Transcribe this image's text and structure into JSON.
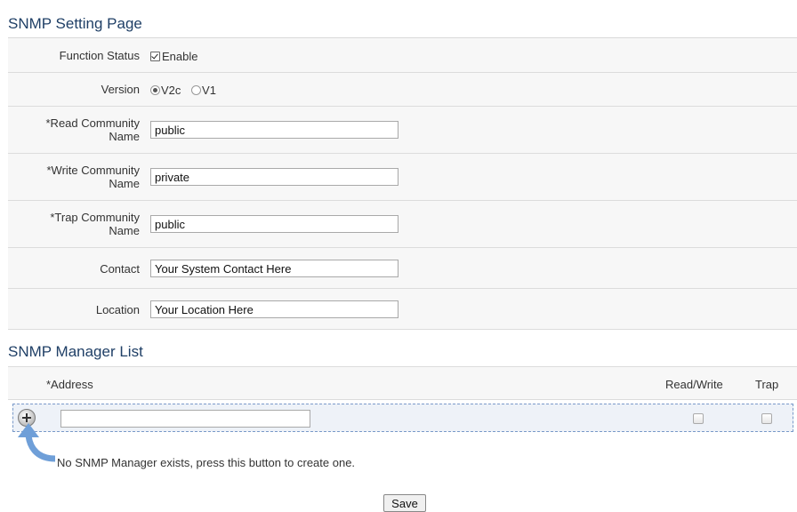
{
  "page_title": "SNMP Setting Page",
  "form": {
    "function_status": {
      "label": "Function Status",
      "checkbox_label": "Enable",
      "checked": true
    },
    "version": {
      "label": "Version",
      "options": [
        "V2c",
        "V1"
      ],
      "selected": "V2c"
    },
    "read_community": {
      "label_line1": "*Read Community",
      "label_line2": "Name",
      "value": "public"
    },
    "write_community": {
      "label_line1": "*Write Community",
      "label_line2": "Name",
      "value": "private"
    },
    "trap_community": {
      "label_line1": "*Trap Community",
      "label_line2": "Name",
      "value": "public"
    },
    "contact": {
      "label": "Contact",
      "value": "Your System Contact Here"
    },
    "location": {
      "label": "Location",
      "value": "Your Location Here"
    }
  },
  "manager_list": {
    "title": "SNMP Manager List",
    "columns": {
      "address": "*Address",
      "read_write": "Read/Write",
      "trap": "Trap"
    },
    "new_row": {
      "address": "",
      "read_write": false,
      "trap": false
    },
    "hint": "No SNMP Manager exists, press this button to create one."
  },
  "save_label": "Save",
  "colors": {
    "title": "#1f3f66",
    "row_bg": "#f7f7f7",
    "dashed_border": "#7a9ac9",
    "arrow": "#6f9fd8"
  }
}
